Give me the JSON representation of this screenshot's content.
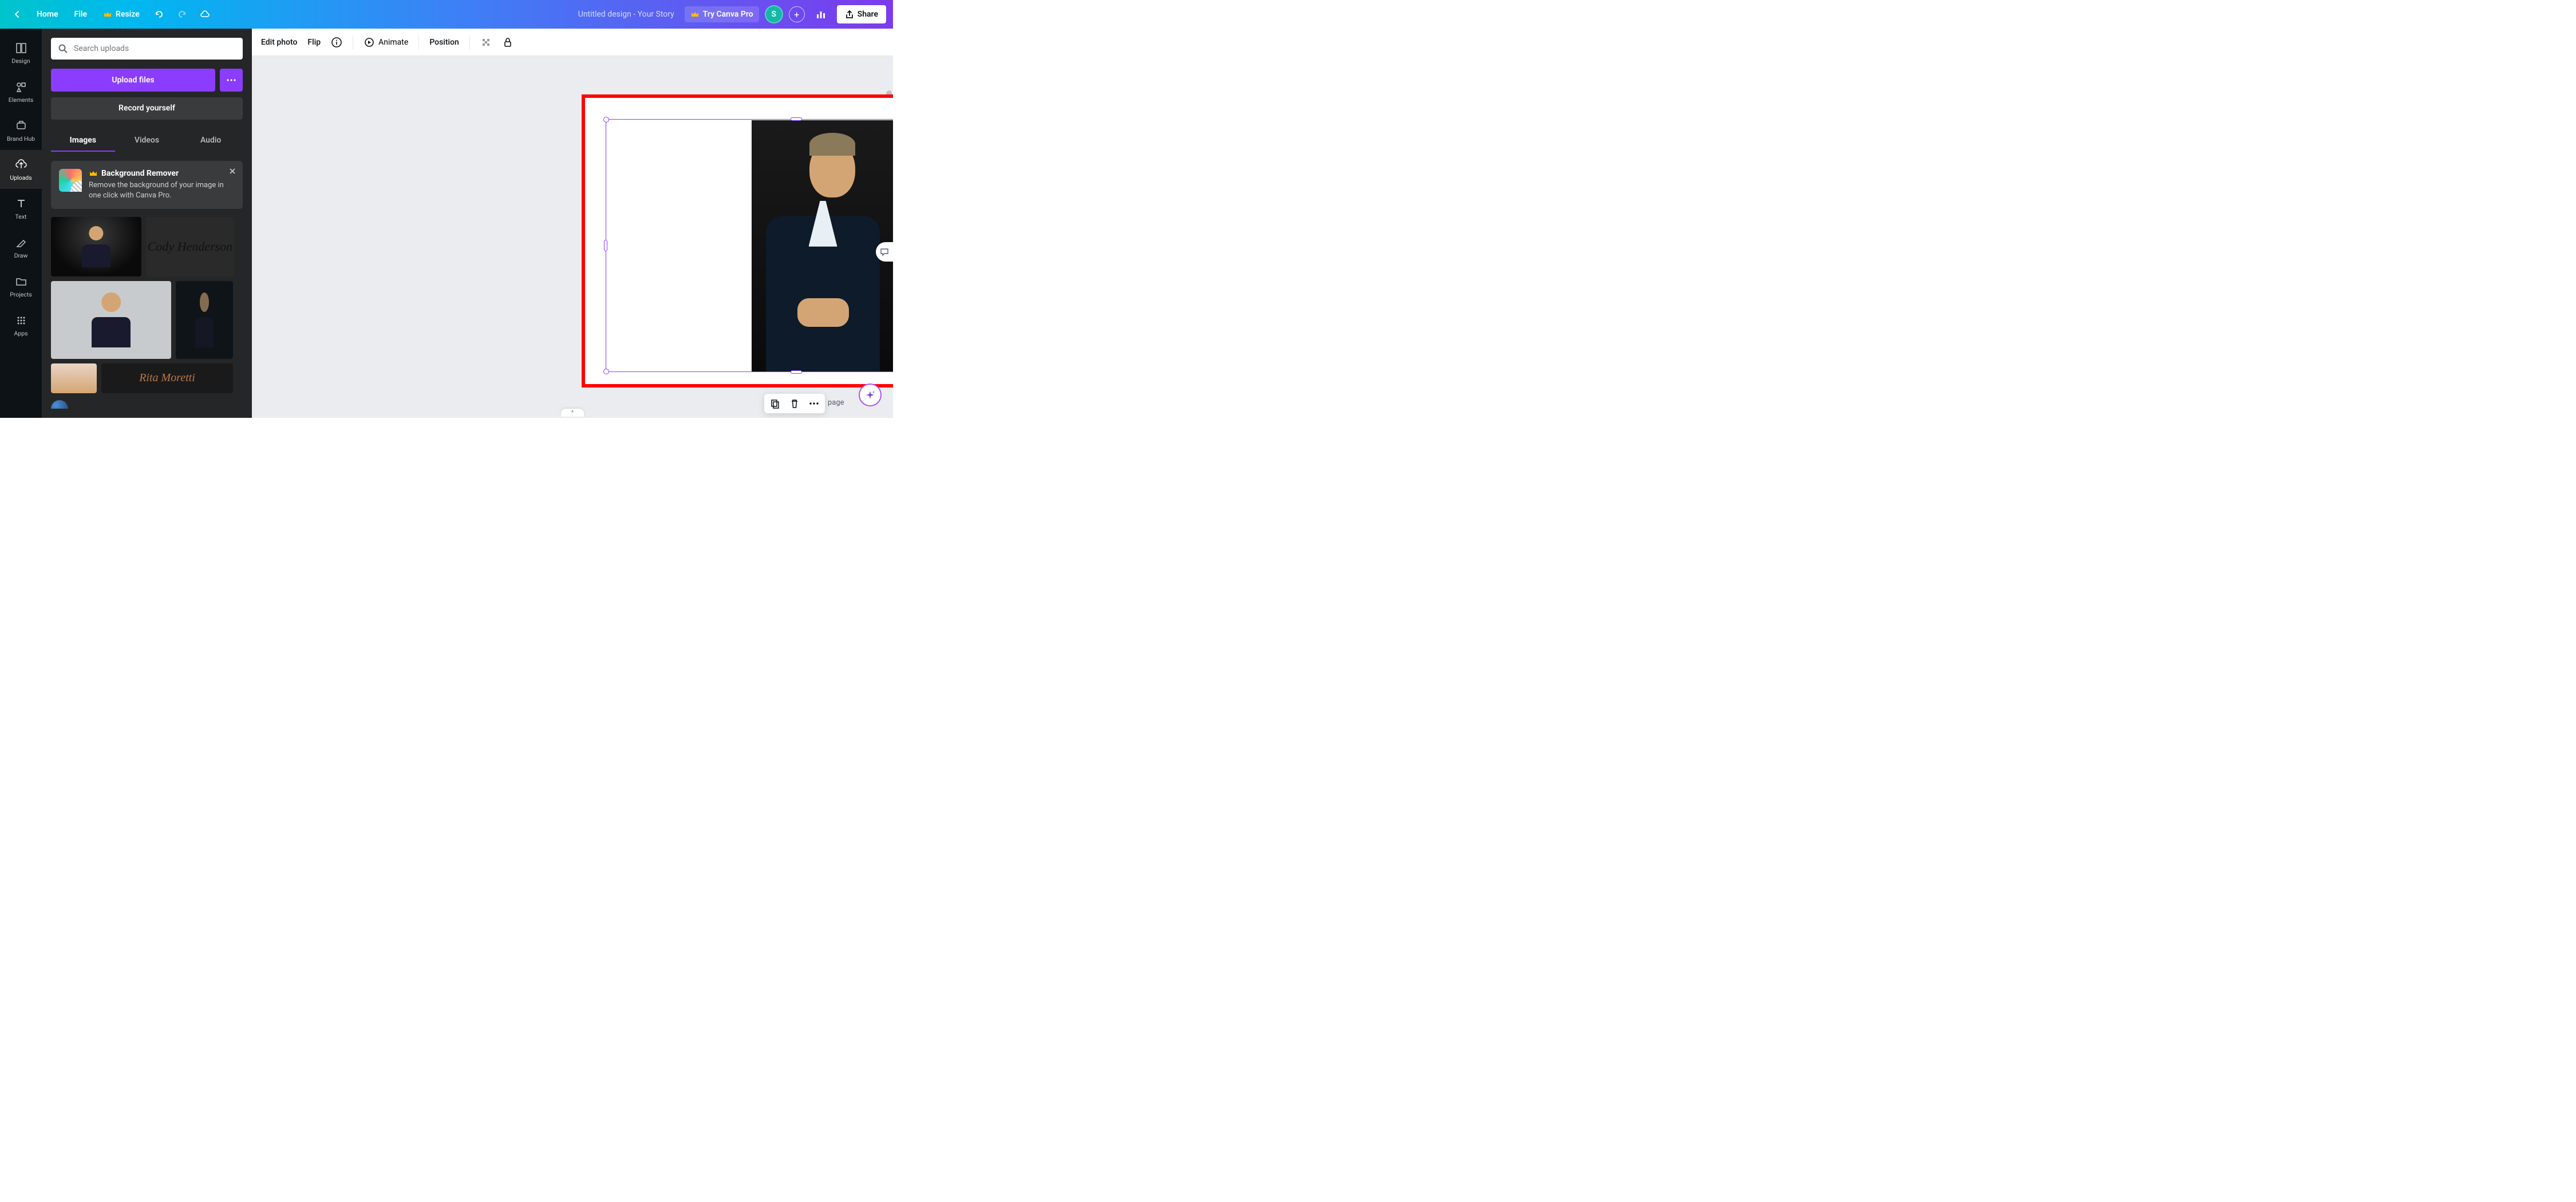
{
  "header": {
    "home": "Home",
    "file": "File",
    "resize": "Resize",
    "doc_title": "Untitled design - Your Story",
    "try_pro": "Try Canva Pro",
    "avatar_initial": "S",
    "share": "Share"
  },
  "nav": {
    "design": "Design",
    "elements": "Elements",
    "brand_hub": "Brand Hub",
    "uploads": "Uploads",
    "text": "Text",
    "draw": "Draw",
    "projects": "Projects",
    "apps": "Apps"
  },
  "panel": {
    "search_placeholder": "Search uploads",
    "upload_files": "Upload files",
    "record_yourself": "Record yourself",
    "tabs": {
      "images": "Images",
      "videos": "Videos",
      "audio": "Audio"
    },
    "promo": {
      "title": "Background Remover",
      "desc": "Remove the background of your image in one click with Canva Pro."
    },
    "thumb_sig1": "Cody Henderson",
    "thumb_sig2": "Rita Moretti"
  },
  "toolbar": {
    "edit_photo": "Edit photo",
    "flip": "Flip",
    "animate": "Animate",
    "position": "Position"
  },
  "canvas": {
    "add_page_suffix": "page"
  }
}
